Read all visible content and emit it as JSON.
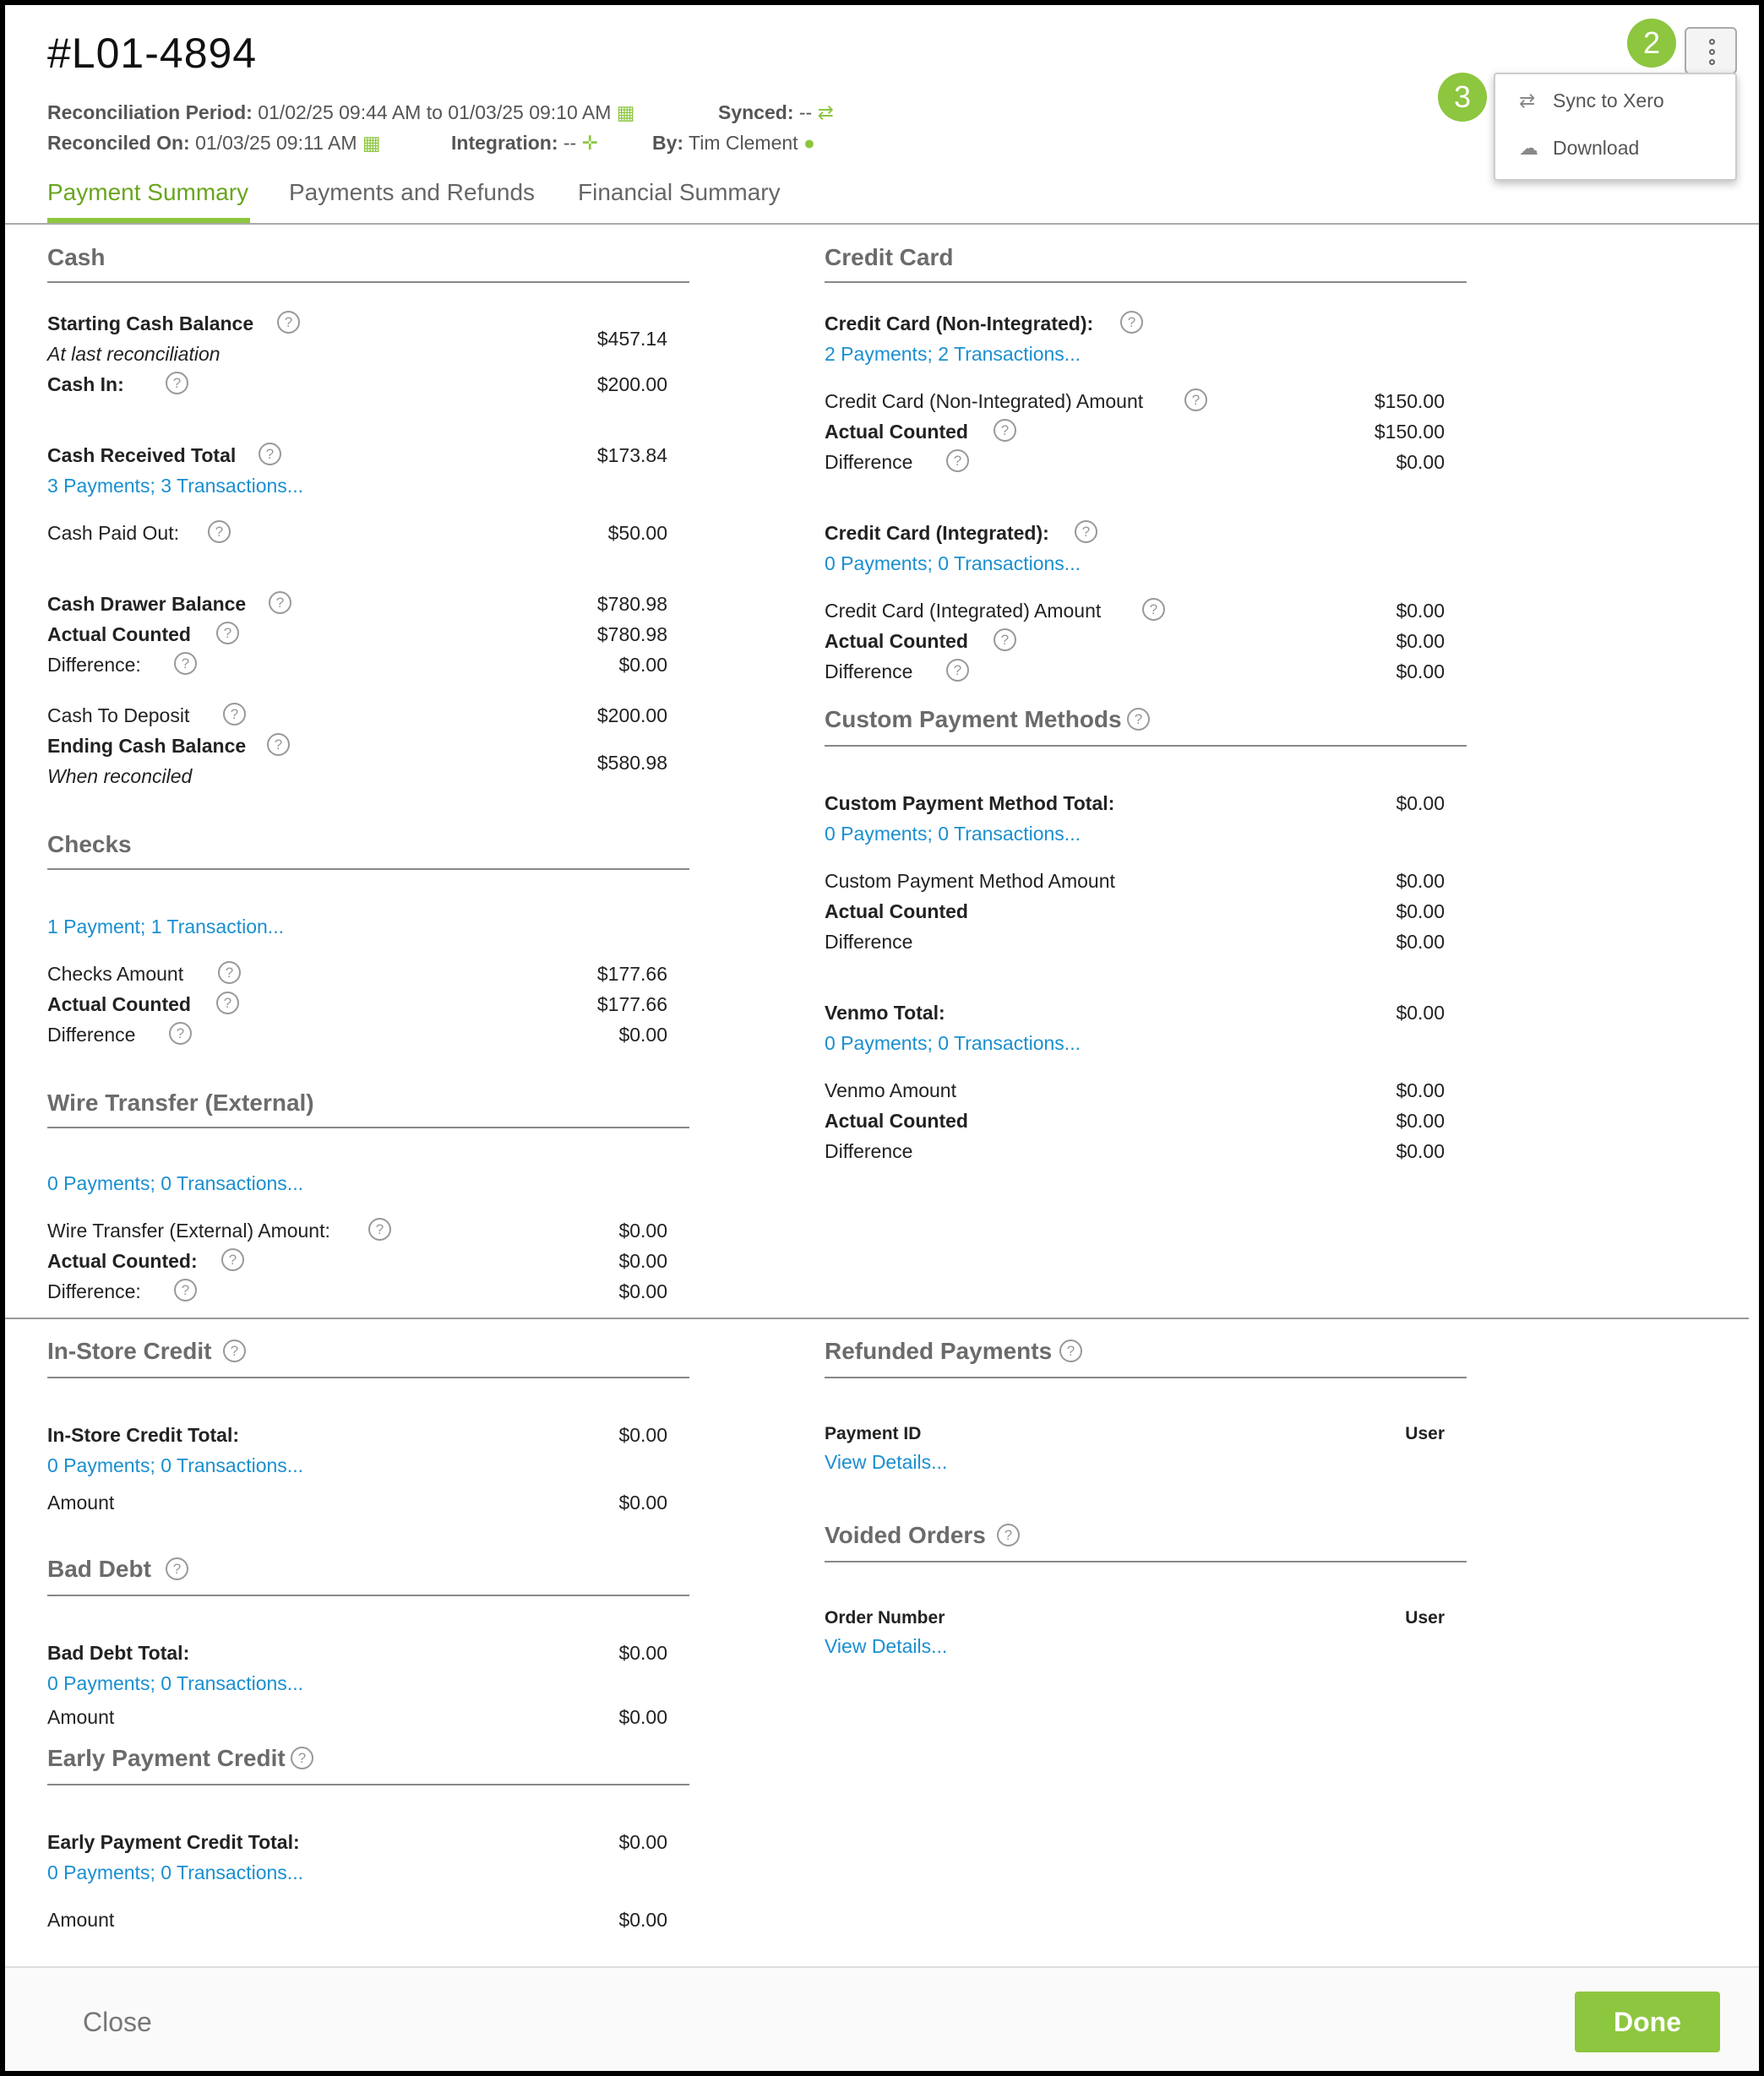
{
  "header": {
    "title": "#L01-4894",
    "recon_period_label": "Reconciliation Period:",
    "recon_period_value": "01/02/25 09:44 AM to 01/03/25 09:10 AM",
    "synced_label": "Synced:",
    "synced_value": "--",
    "reconciled_on_label": "Reconciled On:",
    "reconciled_on_value": "01/03/25 09:11 AM",
    "integration_label": "Integration:",
    "integration_value": "--",
    "by_label": "By:",
    "by_value": "Tim Clement"
  },
  "badges": {
    "b2": "2",
    "b3": "3"
  },
  "menu": {
    "items": [
      {
        "label": "Sync to Xero",
        "icon": "sync-arrows-icon"
      },
      {
        "label": "Download",
        "icon": "cloud-download-icon"
      }
    ]
  },
  "tabs": [
    {
      "label": "Payment Summary",
      "active": true
    },
    {
      "label": "Payments and Refunds"
    },
    {
      "label": "Financial Summary"
    }
  ],
  "help_glyph": "?",
  "cash": {
    "title": "Cash",
    "starting_label": "Starting Cash Balance",
    "starting_sub": "At last reconciliation",
    "starting_value": "$457.14",
    "cash_in_label": "Cash In:",
    "cash_in_value": "$200.00",
    "received_label": "Cash Received Total",
    "received_value": "$173.84",
    "received_link": "3 Payments; 3 Transactions...",
    "paid_out_label": "Cash Paid Out:",
    "paid_out_value": "$50.00",
    "drawer_label": "Cash Drawer Balance",
    "drawer_value": "$780.98",
    "counted_label": "Actual Counted",
    "counted_value": "$780.98",
    "diff_label": "Difference:",
    "diff_value": "$0.00",
    "deposit_label": "Cash To Deposit",
    "deposit_value": "$200.00",
    "ending_label": "Ending Cash Balance",
    "ending_sub": "When reconciled",
    "ending_value": "$580.98"
  },
  "checks": {
    "title": "Checks",
    "link": "1 Payment; 1 Transaction...",
    "amount_label": "Checks Amount",
    "amount_value": "$177.66",
    "counted_label": "Actual Counted",
    "counted_value": "$177.66",
    "diff_label": "Difference",
    "diff_value": "$0.00"
  },
  "wire": {
    "title": "Wire Transfer (External)",
    "link": "0 Payments; 0 Transactions...",
    "amount_label": "Wire Transfer (External) Amount:",
    "amount_value": "$0.00",
    "counted_label": "Actual Counted:",
    "counted_value": "$0.00",
    "diff_label": "Difference:",
    "diff_value": "$0.00"
  },
  "credit": {
    "title": "Credit Card",
    "ni_label": "Credit Card (Non-Integrated):",
    "ni_link": "2 Payments; 2 Transactions...",
    "ni_amount_label": "Credit Card (Non-Integrated) Amount",
    "ni_amount_value": "$150.00",
    "ni_counted_label": "Actual Counted",
    "ni_counted_value": "$150.00",
    "ni_diff_label": "Difference",
    "ni_diff_value": "$0.00",
    "i_label": "Credit Card (Integrated):",
    "i_link": "0 Payments; 0 Transactions...",
    "i_amount_label": "Credit Card (Integrated) Amount",
    "i_amount_value": "$0.00",
    "i_counted_label": "Actual Counted",
    "i_counted_value": "$0.00",
    "i_diff_label": "Difference",
    "i_diff_value": "$0.00"
  },
  "custom": {
    "title": "Custom Payment Methods",
    "total_label": "Custom Payment Method Total:",
    "total_value": "$0.00",
    "total_link": "0 Payments; 0 Transactions...",
    "amount_label": "Custom Payment Method Amount",
    "amount_value": "$0.00",
    "counted_label": "Actual Counted",
    "counted_value": "$0.00",
    "diff_label": "Difference",
    "diff_value": "$0.00",
    "venmo_label": "Venmo Total:",
    "venmo_value": "$0.00",
    "venmo_link": "0 Payments; 0 Transactions...",
    "venmo_amount_label": "Venmo Amount",
    "venmo_amount_value": "$0.00",
    "venmo_counted_label": "Actual Counted",
    "venmo_counted_value": "$0.00",
    "venmo_diff_label": "Difference",
    "venmo_diff_value": "$0.00"
  },
  "instore": {
    "title": "In-Store Credit",
    "total_label": "In-Store Credit Total:",
    "total_value": "$0.00",
    "link": "0 Payments; 0 Transactions...",
    "amount_label": "Amount",
    "amount_value": "$0.00"
  },
  "baddebt": {
    "title": "Bad Debt",
    "total_label": "Bad Debt Total:",
    "total_value": "$0.00",
    "link": "0 Payments; 0 Transactions...",
    "amount_label": "Amount",
    "amount_value": "$0.00"
  },
  "early": {
    "title": "Early Payment Credit",
    "total_label": "Early Payment Credit Total:",
    "total_value": "$0.00",
    "link": "0 Payments; 0 Transactions...",
    "amount_label": "Amount",
    "amount_value": "$0.00"
  },
  "refunded": {
    "title": "Refunded Payments",
    "col1": "Payment ID",
    "col2": "User",
    "link": "View Details..."
  },
  "voided": {
    "title": "Voided Orders",
    "col1": "Order Number",
    "col2": "User",
    "link": "View Details..."
  },
  "footer": {
    "close": "Close",
    "done": "Done"
  },
  "colors": {
    "accent": "#8dc63f",
    "link": "#1a8fd0",
    "tab_active": "#6aa51f"
  }
}
